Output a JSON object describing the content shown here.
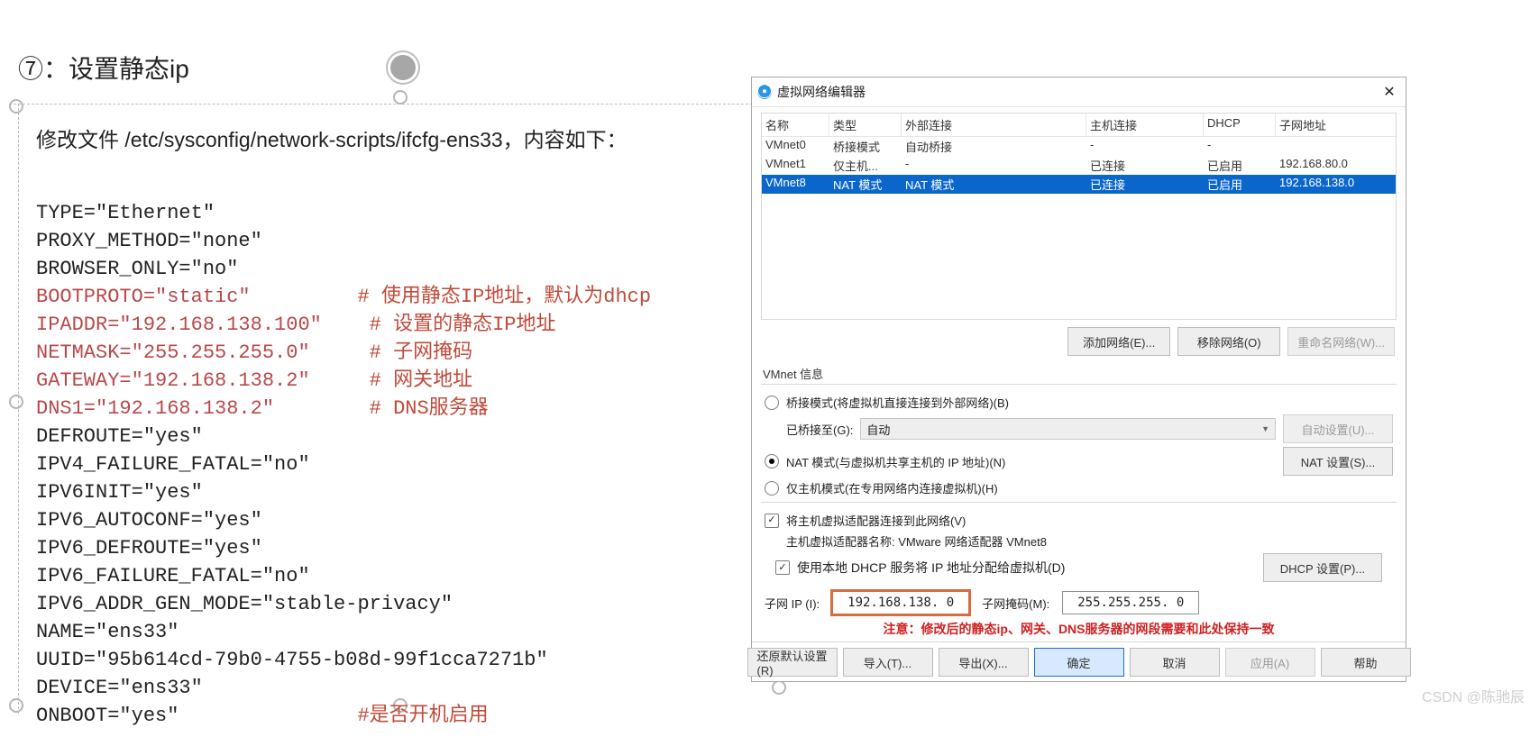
{
  "left": {
    "step": "⑦：设置静态ip",
    "desc": "修改文件 /etc/sysconfig/network-scripts/ifcfg-ens33，内容如下：",
    "lines": {
      "l1": "TYPE=\"Ethernet\"",
      "l2": "PROXY_METHOD=\"none\"",
      "l3": "BROWSER_ONLY=\"no\"",
      "l4": "BOOTPROTO=\"static\"",
      "l4c": "# 使用静态IP地址，默认为dhcp",
      "l5": "IPADDR=\"192.168.138.100\"",
      "l5c": "# 设置的静态IP地址",
      "l6": "NETMASK=\"255.255.255.0\"",
      "l6c": "# 子网掩码",
      "l7": "GATEWAY=\"192.168.138.2\"",
      "l7c": "# 网关地址",
      "l8": "DNS1=\"192.168.138.2\"",
      "l8c": "# DNS服务器",
      "l9": "DEFROUTE=\"yes\"",
      "l10": "IPV4_FAILURE_FATAL=\"no\"",
      "l11": "IPV6INIT=\"yes\"",
      "l12": "IPV6_AUTOCONF=\"yes\"",
      "l13": "IPV6_DEFROUTE=\"yes\"",
      "l14": "IPV6_FAILURE_FATAL=\"no\"",
      "l15": "IPV6_ADDR_GEN_MODE=\"stable-privacy\"",
      "l16": "NAME=\"ens33\"",
      "l17": "UUID=\"95b614cd-79b0-4755-b08d-99f1cca7271b\"",
      "l18": "DEVICE=\"ens33\"",
      "l19": "ONBOOT=\"yes\"",
      "l19c": "#是否开机启用"
    }
  },
  "dialog": {
    "title": "虚拟网络编辑器",
    "columns": {
      "name": "名称",
      "type": "类型",
      "ext": "外部连接",
      "host": "主机连接",
      "dhcp": "DHCP",
      "subnet": "子网地址"
    },
    "rows": [
      {
        "name": "VMnet0",
        "type": "桥接模式",
        "ext": "自动桥接",
        "host": "-",
        "dhcp": "-",
        "subnet": ""
      },
      {
        "name": "VMnet1",
        "type": "仅主机...",
        "ext": "-",
        "host": "已连接",
        "dhcp": "已启用",
        "subnet": "192.168.80.0"
      },
      {
        "name": "VMnet8",
        "type": "NAT 模式",
        "ext": "NAT 模式",
        "host": "已连接",
        "dhcp": "已启用",
        "subnet": "192.168.138.0"
      }
    ],
    "buttons": {
      "add": "添加网络(E)...",
      "remove": "移除网络(O)",
      "rename": "重命名网络(W)..."
    },
    "info_label": "VMnet 信息",
    "modes": {
      "bridge": "桥接模式(将虚拟机直接连接到外部网络)(B)",
      "bridge_to_label": "已桥接至(G):",
      "bridge_to_value": "自动",
      "bridge_auto_btn": "自动设置(U)...",
      "nat": "NAT 模式(与虚拟机共享主机的 IP 地址)(N)",
      "nat_btn": "NAT 设置(S)...",
      "hostonly": "仅主机模式(在专用网络内连接虚拟机)(H)"
    },
    "host_adapter": {
      "use": "将主机虚拟适配器连接到此网络(V)",
      "name_label": "主机虚拟适配器名称: VMware 网络适配器 VMnet8"
    },
    "dhcp": {
      "use": "使用本地 DHCP 服务将 IP 地址分配给虚拟机(D)",
      "btn": "DHCP 设置(P)..."
    },
    "subnet": {
      "ip_label": "子网 IP (I):",
      "ip_value": "192.168.138. 0",
      "mask_label": "子网掩码(M):",
      "mask_value": "255.255.255. 0"
    },
    "note": "注意：修改后的静态ip、网关、DNS服务器的网段需要和此处保持一致",
    "footer": {
      "restore": "还原默认设置(R)",
      "import": "导入(T)...",
      "export": "导出(X)...",
      "ok": "确定",
      "cancel": "取消",
      "apply": "应用(A)",
      "help": "帮助"
    }
  },
  "watermark": "CSDN @陈驰辰"
}
